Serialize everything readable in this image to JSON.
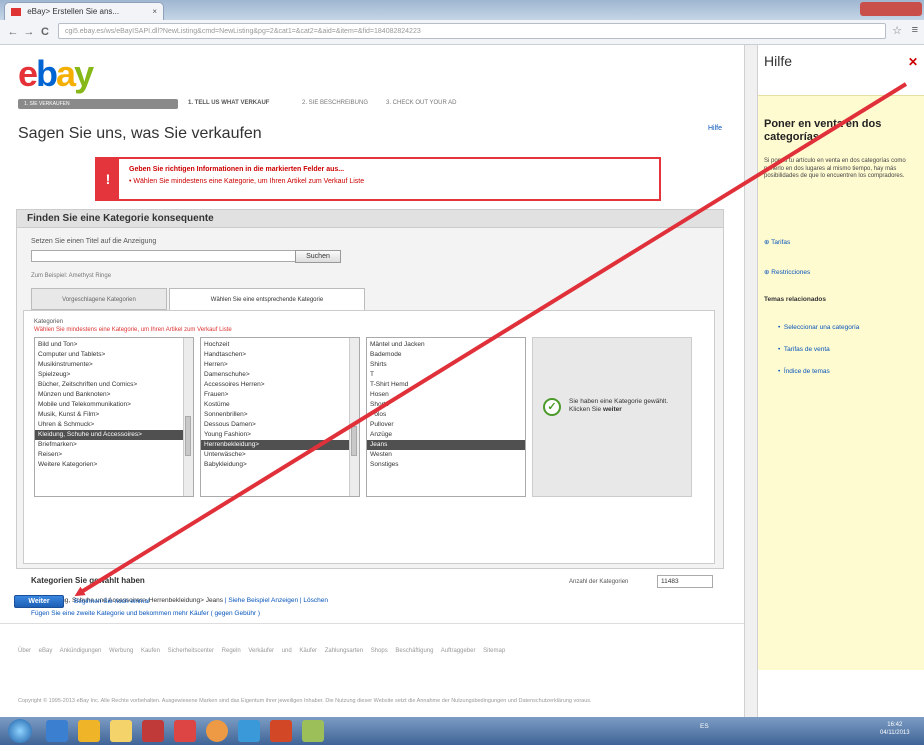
{
  "browser": {
    "tab_title": "eBay> Erstellen Sie ans...",
    "tab_close": "×",
    "back": "←",
    "forward": "→",
    "reload": "C",
    "url": "cgi5.ebay.es/ws/eBayISAPI.dll?NewListing&cmd=NewListing&pg=2&cat1=&cat2=&aid=&item=&fid=184082824223",
    "star_icon": "☆",
    "menu_icon": "≡"
  },
  "header": {
    "logo": {
      "e": "e",
      "b": "b",
      "a": "a",
      "y": "y"
    },
    "stepbar": "1. SIE VERKAUFEN",
    "steps": [
      "1. TELL US WHAT VERKAUF",
      "2. SIE BESCHREIBUNG",
      "3. CHECK OUT YOUR AD"
    ],
    "page_title": "Sagen Sie uns, was Sie verkaufen",
    "help_link": "Hilfe"
  },
  "error": {
    "icon": "!",
    "line1": "Geben Sie richtigen Informationen in die markierten Felder aus...",
    "line2": "•  Wählen Sie mindestens eine Kategorie, um Ihren Artikel zum Verkauf Liste"
  },
  "category_panel": {
    "heading": "Finden Sie eine Kategorie konsequente",
    "title_label": "Setzen Sie einen Titel auf die Anzeigung",
    "search_button": "Suchen",
    "example": "Zum Beispiel: Amethyst Ringe",
    "tabs": [
      "Vorgeschlagene Kategorien",
      "Wählen Sie eine entsprechende Kategorie"
    ],
    "kategorien_label": "Kategorien",
    "kategorien_error": "Wählen Sie mindestens eine Kategorie, um Ihren Artikel zum Verkauf Liste",
    "list1": [
      "Bild und Ton>",
      "Computer und Tablets>",
      "Musikinstrumente>",
      "Spielzeug>",
      "Bücher, Zeitschriften und Comics>",
      "Münzen und Banknoten>",
      "Mobile und Telekommunikation>",
      "Musik, Kunst & Film>",
      "Uhren & Schmuck>",
      "Kleidung, Schuhe und Accessoires>",
      "Briefmarken>",
      "Reisen>",
      "Weitere Kategorien>"
    ],
    "list1_selected": 9,
    "list2": [
      "Hochzeit",
      "Handtaschen>",
      "Herren>",
      "Damenschuhe>",
      "Accessoires Herren>",
      "Frauen>",
      "Kostüme",
      "Sonnenbrillen>",
      "Dessous Damen>",
      "Young Fashion>",
      "Herrenbekleidung>",
      "Unterwäsche>",
      "Babykleidung>"
    ],
    "list2_selected": 10,
    "list3": [
      "Mäntel und Jacken",
      "Bademode",
      "Shirts",
      "T",
      "T-Shirt Hemd",
      "Hosen",
      "Shorts",
      "Polos",
      "Pullover",
      "Anzüge",
      "Jeans",
      "Westen",
      "Sonstiges"
    ],
    "list3_selected": 10,
    "selected_message_1": "Sie haben eine Kategorie gewählt. Klicken Sie",
    "selected_message_2": "weiter",
    "check_icon": "✓",
    "chosen_title": "Kategorien Sie gewählt haben",
    "count_label": "Anzahl der Kategorien",
    "count_value": "11483",
    "path": "•  Kleidung, Schuhe und Accessoires> Herrenbekleidung> Jeans",
    "path_links": "| Siehe Beispiel Anzeigen | Löschen",
    "add_category": "Fügen Sie eine zweite Kategorie und bekommen mehr Käufer  ( gegen Gebühr )"
  },
  "actions": {
    "weiter": "Weiter",
    "begin_again": "Beginnen Sie noch einmal"
  },
  "footer": {
    "links": "Über eBay   Ankündigungen   Werbung   Kaufen   Sicherheitscenter   Regeln   Verkäufer und Käufer   Zahlungsarten   Shops   Beschäftigung   Auftraggeber   Sitemap",
    "copyright": "Copyright © 1995-2013 eBay Inc. Alle Rechte vorbehalten. Ausgewiesene Marken sind das Eigentum ihrer jeweiligen Inhaber. Die Nutzung dieser Website setzt die Annahme der Nutzungsbedingungen und Datenschutzerklärung voraus."
  },
  "help": {
    "title": "Hilfe",
    "close_icon": "✕",
    "heading": "Poner en venta en dos categorías",
    "body": "Si pones tu artículo en venta en dos categorías como ponerlo en dos lugares al mismo tiempo, hay más posibilidades de que lo encuentren los compradores.",
    "items": [
      "Tarifas",
      "Restricciones"
    ],
    "related_title": "Temas relacionados",
    "related": [
      "Seleccionar una categoría",
      "Tarifas de venta",
      "Índice de temas"
    ]
  },
  "taskbar": {
    "tray": "ES",
    "clock_time": "16:42",
    "clock_date": "04/11/2013"
  },
  "colors": {
    "error_red": "#e5353c",
    "link_blue": "#0654ba",
    "arrow_red": "#e0303a",
    "help_yellow": "#fffbd1"
  }
}
